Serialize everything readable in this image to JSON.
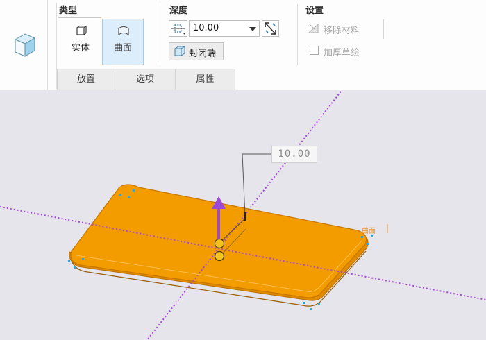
{
  "ribbon": {
    "type_group": {
      "title": "类型",
      "solid_label": "实体",
      "surface_label": "曲面",
      "selected": "曲面"
    },
    "depth_group": {
      "title": "深度",
      "value": "10.00",
      "cap_ends_label": "封闭端"
    },
    "settings_group": {
      "title": "设置",
      "remove_material_label": "移除材料",
      "thicken_sketch_label": "加厚草绘"
    },
    "tabs": [
      {
        "label": "放置"
      },
      {
        "label": "选项"
      },
      {
        "label": "属性"
      }
    ]
  },
  "viewport": {
    "depth_dimension": "10.00",
    "surface_label": "曲面",
    "colors": {
      "background": "#e5e5eb",
      "extrusion": "#f39c00",
      "axis": "#a64ad8",
      "drag_arrow": "#9b48d6",
      "handle": "#f4c21a"
    }
  },
  "icons": {
    "feature": "extrude-feature-icon",
    "solid": "solid-icon",
    "surface": "surface-icon",
    "depth_option": "blind-depth-icon",
    "flip": "flip-direction-icon",
    "cap_ends": "cap-ends-icon",
    "remove_material": "remove-material-icon"
  }
}
